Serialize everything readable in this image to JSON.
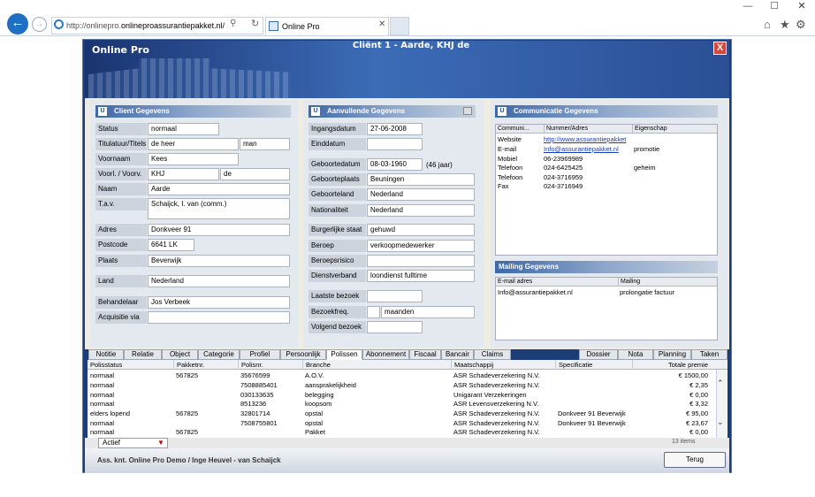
{
  "browser": {
    "url_prefix": "http://onlinepro.",
    "url_host": "onlineproassurantiepakket.nl/",
    "tab_title": "Online Pro",
    "controls": {
      "minimize": "—",
      "maximize": "☐",
      "close": "✕"
    }
  },
  "app": {
    "name": "Online Pro",
    "title": "Cliënt 1 - Aarde, KHJ de",
    "close": "X"
  },
  "client_panel": {
    "title": "Client Gegevens",
    "fields": [
      {
        "label": "Status",
        "value": "normaal"
      },
      {
        "label": "Titulatuur/Titels",
        "value": "de heer",
        "value2": "man"
      },
      {
        "label": "Voornaam",
        "value": "Kees"
      },
      {
        "label": "Voorl. / Voorv.",
        "value": "KHJ",
        "value2": "de"
      },
      {
        "label": "Naam",
        "value": "Aarde"
      },
      {
        "label": "T.a.v.",
        "value": "Schaijck, I. van (comm.)"
      },
      {
        "label": "Adres",
        "value": "Donkveer 91"
      },
      {
        "label": "Postcode",
        "value": "6641 LK"
      },
      {
        "label": "Plaats",
        "value": "Beverwijk"
      },
      {
        "label": "Land",
        "value": "Nederland"
      },
      {
        "label": "Behandelaar",
        "value": "Jos Verbeek"
      },
      {
        "label": "Acquisitie via",
        "value": ""
      }
    ]
  },
  "extra_panel": {
    "title": "Aanvullende Gegevens",
    "age_note": "(46 jaar)",
    "fields": [
      {
        "label": "Ingangsdatum",
        "value": "27-06-2008"
      },
      {
        "label": "Einddatum",
        "value": ""
      },
      {
        "label": "Geboortedatum",
        "value": "08-03-1960"
      },
      {
        "label": "Geboorteplaats",
        "value": "Beuningen"
      },
      {
        "label": "Geboorteland",
        "value": "Nederland"
      },
      {
        "label": "Nationaliteit",
        "value": "Nederland"
      },
      {
        "label": "Burgerlijke staat",
        "value": "gehuwd"
      },
      {
        "label": "Beroep",
        "value": "verkoopmedewerker"
      },
      {
        "label": "Beroepsrisico",
        "value": ""
      },
      {
        "label": "Dienstverband",
        "value": "loondienst fulltime"
      },
      {
        "label": "Laatste bezoek",
        "value": ""
      },
      {
        "label": "Bezoekfreq.",
        "value": "",
        "value2": "maanden"
      },
      {
        "label": "Volgend bezoek",
        "value": ""
      }
    ]
  },
  "comm_panel": {
    "title": "Communicatie Gegevens",
    "headers": [
      "Communi...",
      "Nummer/Adres",
      "Eigenschap"
    ],
    "rows": [
      [
        "Website",
        "http://www.assurantiepakket",
        ""
      ],
      [
        "E-mail",
        "Info@assurantiepakket.nl",
        "promotie"
      ],
      [
        "Mobiel",
        "06-23969989",
        ""
      ],
      [
        "Telefoon",
        "024-6425425",
        "geheim"
      ],
      [
        "Telefoon",
        "024-3716959",
        ""
      ],
      [
        "Fax",
        "024-3716949",
        ""
      ]
    ]
  },
  "mailing_panel": {
    "title": "Mailing Gegevens",
    "headers": [
      "E-mail adres",
      "Mailing"
    ],
    "rows": [
      [
        "Info@assurantiepakket.nl",
        "prolongatie factuur"
      ]
    ]
  },
  "tabs_left": [
    "Notitie",
    "Relatie",
    "Object",
    "Categorie",
    "Profiel",
    "Persoonlijk",
    "Polissen",
    "Abonnement",
    "Fiscaal",
    "Bancair",
    "Claims"
  ],
  "active_tab": "Polissen",
  "tabs_right": [
    "Dossier",
    "Nota",
    "Planning",
    "Taken"
  ],
  "policies": {
    "headers": [
      "Polisstatus",
      "Pakketnr.",
      "Polisnr.",
      "Branche",
      "Maatschappij",
      "Specificatie",
      "Totale premie"
    ],
    "rows": [
      [
        "normaal",
        "567825",
        "35676599",
        "A.O.V.",
        "ASR Schadeverzekering N.V.",
        "",
        "€ 1500,00"
      ],
      [
        "normaal",
        "",
        "7508885401",
        "aansprakelijkheid",
        "ASR Schadeverzekering N.V.",
        "",
        "€ 2,35"
      ],
      [
        "normaal",
        "",
        "030133635",
        "belegging",
        "Unigarant Verzekeringen",
        "",
        "€ 0,00"
      ],
      [
        "normaal",
        "",
        "8513236",
        "koopsom",
        "ASR Levensverzekering N.V.",
        "",
        "€ 3,32"
      ],
      [
        "elders lopend",
        "567825",
        "32801714",
        "opstal",
        "ASR Schadeverzekering N.V.",
        "Donkveer 91 Beverwijk",
        "€ 95,00"
      ],
      [
        "normaal",
        "",
        "7508755801",
        "opstal",
        "ASR Schadeverzekering N.V.",
        "Donkveer 91 Beverwijk",
        "€ 23,67"
      ],
      [
        "normaal",
        "567825",
        "",
        "Pakket",
        "ASR Schadeverzekering N.V.",
        "",
        "€ 0,00"
      ]
    ]
  },
  "footer": {
    "filter_value": "Actief",
    "items_count": "13 items",
    "status_text": "Ass. knt. Online Pro Demo / Inge Heuvel - van Schaijck",
    "back_button": "Terug"
  },
  "colors": {
    "accent": "#1c3d78",
    "header_gradient_start": "#3e68a8",
    "close_red": "#d9463a"
  }
}
